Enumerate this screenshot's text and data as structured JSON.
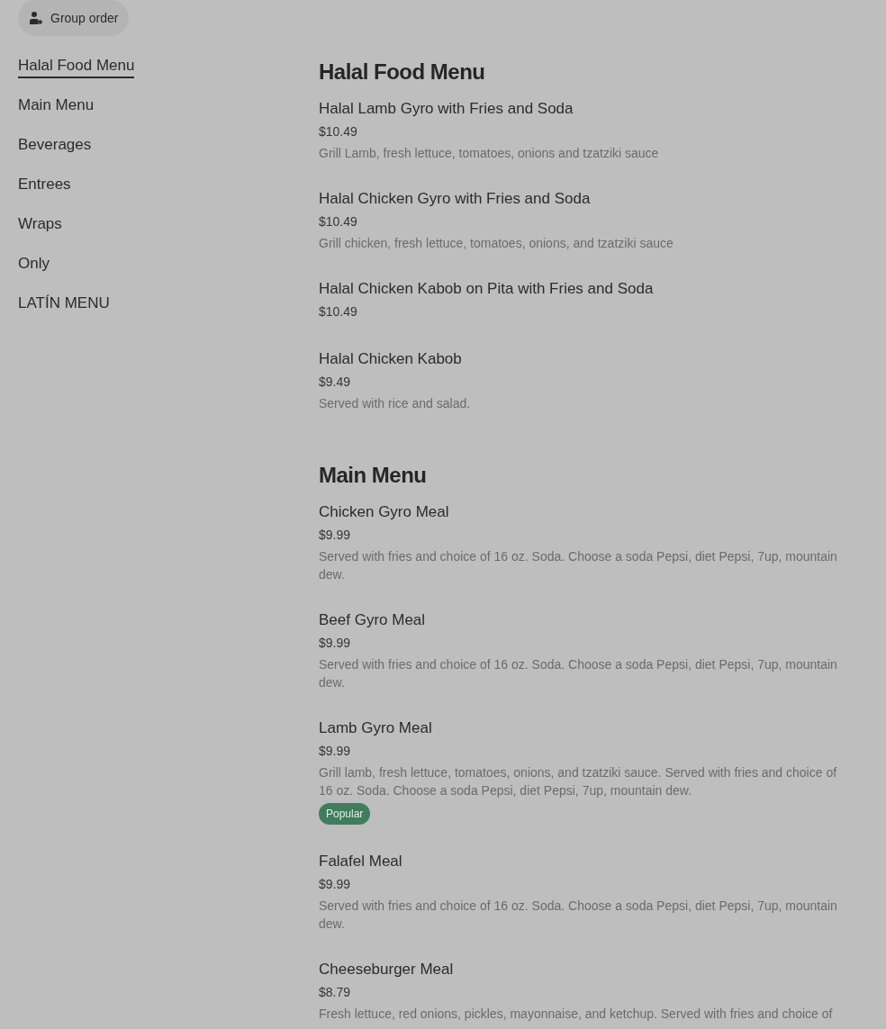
{
  "group_order_button": {
    "label": "Group order"
  },
  "sidebar": {
    "items": [
      {
        "label": "Halal Food Menu",
        "selected": true
      },
      {
        "label": "Main Menu",
        "selected": false
      },
      {
        "label": "Beverages",
        "selected": false
      },
      {
        "label": "Entrees",
        "selected": false
      },
      {
        "label": "Wraps",
        "selected": false
      },
      {
        "label": "Only",
        "selected": false
      },
      {
        "label": "LATÍN MENU",
        "selected": false
      }
    ]
  },
  "sections": [
    {
      "title": "Halal Food Menu",
      "items": [
        {
          "name": "Halal Lamb Gyro with Fries and Soda",
          "price": "$10.49",
          "description": "Grill Lamb, fresh lettuce, tomatoes, onions and tzatziki sauce"
        },
        {
          "name": "Halal Chicken Gyro with Fries and Soda",
          "price": "$10.49",
          "description": "Grill chicken, fresh lettuce, tomatoes, onions, and tzatziki sauce"
        },
        {
          "name": "Halal Chicken Kabob on Pita with Fries and Soda",
          "price": "$10.49"
        },
        {
          "name": "Halal Chicken Kabob",
          "price": "$9.49",
          "description": "Served with rice and salad."
        }
      ]
    },
    {
      "title": "Main Menu",
      "items": [
        {
          "name": "Chicken Gyro Meal",
          "price": "$9.99",
          "description": "Served with fries and choice of 16 oz. Soda. Choose a soda Pepsi, diet Pepsi, 7up, mountain dew."
        },
        {
          "name": "Beef Gyro Meal",
          "price": "$9.99",
          "description": "Served with fries and choice of 16 oz. Soda. Choose a soda Pepsi, diet Pepsi, 7up, mountain dew."
        },
        {
          "name": "Lamb Gyro Meal",
          "price": "$9.99",
          "description": "Grill lamb, fresh lettuce, tomatoes, onions, and tzatziki sauce. Served with fries and choice of 16 oz. Soda. Choose a soda Pepsi, diet Pepsi, 7up, mountain dew.",
          "badge": "Popular"
        },
        {
          "name": "Falafel Meal",
          "price": "$9.99",
          "description": "Served with fries and choice of 16 oz. Soda. Choose a soda Pepsi, diet Pepsi, 7up, mountain dew."
        },
        {
          "name": "Cheeseburger Meal",
          "price": "$8.79",
          "description": "Fresh lettuce, red onions, pickles, mayonnaise, and ketchup. Served with fries and choice of"
        }
      ]
    }
  ]
}
